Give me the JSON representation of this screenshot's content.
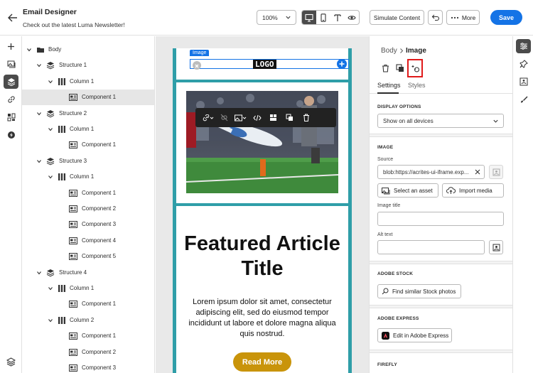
{
  "header": {
    "title": "Email Designer",
    "subtitle": "Check out the latest Luma Newsletter!",
    "zoom": "100%",
    "simulate_label": "Simulate Content",
    "more_label": "More",
    "save_label": "Save"
  },
  "tree": [
    {
      "label": "Body",
      "level": 0,
      "type": "folder",
      "expandable": true
    },
    {
      "label": "Structure 1",
      "level": 1,
      "type": "structure",
      "expandable": true
    },
    {
      "label": "Column 1",
      "level": 2,
      "type": "column",
      "expandable": true
    },
    {
      "label": "Component 1",
      "level": 3,
      "type": "component",
      "selected": true
    },
    {
      "label": "Structure 2",
      "level": 1,
      "type": "structure",
      "expandable": true
    },
    {
      "label": "Column 1",
      "level": 2,
      "type": "column",
      "expandable": true
    },
    {
      "label": "Component 1",
      "level": 3,
      "type": "component"
    },
    {
      "label": "Structure 3",
      "level": 1,
      "type": "structure",
      "expandable": true
    },
    {
      "label": "Column 1",
      "level": 2,
      "type": "column",
      "expandable": true
    },
    {
      "label": "Component 1",
      "level": 3,
      "type": "component"
    },
    {
      "label": "Component 2",
      "level": 3,
      "type": "component"
    },
    {
      "label": "Component 3",
      "level": 3,
      "type": "component"
    },
    {
      "label": "Component 4",
      "level": 3,
      "type": "component"
    },
    {
      "label": "Component 5",
      "level": 3,
      "type": "component"
    },
    {
      "label": "Structure 4",
      "level": 1,
      "type": "structure",
      "expandable": true
    },
    {
      "label": "Column 1",
      "level": 2,
      "type": "column",
      "expandable": true
    },
    {
      "label": "Component 1",
      "level": 3,
      "type": "component"
    },
    {
      "label": "Column 2",
      "level": 2,
      "type": "column",
      "expandable": true
    },
    {
      "label": "Component 1",
      "level": 3,
      "type": "component"
    },
    {
      "label": "Component 2",
      "level": 3,
      "type": "component"
    },
    {
      "label": "Component 3",
      "level": 3,
      "type": "component"
    }
  ],
  "canvas": {
    "image_tag": "Image",
    "logo_text": "LOGO",
    "headline": "Featured Article Title",
    "body": "Lorem ipsum dolor sit amet, consectetur adipiscing elit, sed do eiusmod tempor incididunt ut labore et dolore magna aliqua quis nostrud.",
    "cta": "Read More"
  },
  "panel": {
    "breadcrumb_parent": "Body",
    "breadcrumb_current": "Image",
    "tab_settings": "Settings",
    "tab_styles": "Styles",
    "display_options_title": "DISPLAY OPTIONS",
    "display_options_value": "Show on all devices",
    "image_title": "IMAGE",
    "source_label": "Source",
    "source_value": "blob:https://acrites-ui-iframe.exp...",
    "select_asset_label": "Select an asset",
    "import_media_label": "Import media",
    "image_title_label": "Image title",
    "image_title_value": "",
    "alt_text_label": "Alt text",
    "alt_text_value": "",
    "adobe_stock_title": "ADOBE STOCK",
    "stock_button_label": "Find similar Stock photos",
    "adobe_express_title": "ADOBE EXPRESS",
    "express_button_label": "Edit in Adobe Express",
    "firefly_title": "FIREFLY"
  },
  "colors": {
    "accent": "#1473e6",
    "email_border": "#2f9ea8",
    "cta": "#c9940a",
    "highlight": "#e01a1a"
  }
}
